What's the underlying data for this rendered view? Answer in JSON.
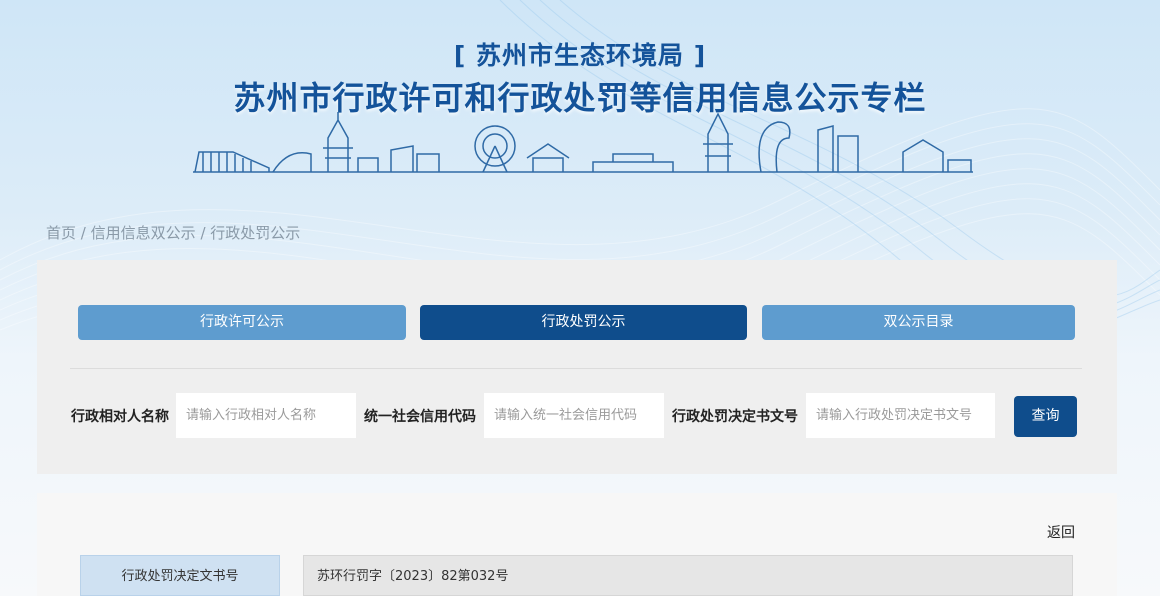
{
  "header": {
    "subtitle": "[ 苏州市生态环境局 ]",
    "title": "苏州市行政许可和行政处罚等信用信息公示专栏"
  },
  "breadcrumb": {
    "home": "首页",
    "sep": "/",
    "level2": "信用信息双公示",
    "level3": "行政处罚公示"
  },
  "tabs": [
    {
      "label": "行政许可公示"
    },
    {
      "label": "行政处罚公示",
      "active": true
    },
    {
      "label": "双公示目录"
    }
  ],
  "search": {
    "name_label": "行政相对人名称",
    "name_placeholder": "请输入行政相对人名称",
    "code_label": "统一社会信用代码",
    "code_placeholder": "请输入统一社会信用代码",
    "doc_label": "行政处罚决定书文号",
    "doc_placeholder": "请输入行政处罚决定书文号",
    "query_label": "查询"
  },
  "detail": {
    "back_label": "返回",
    "rows": [
      {
        "label": "行政处罚决定文书号",
        "value": "苏环行罚字〔2023〕82第032号"
      }
    ]
  },
  "colors": {
    "primary": "#0f4d8c",
    "tab_inactive": "#5e9ccf",
    "title": "#14539a"
  }
}
